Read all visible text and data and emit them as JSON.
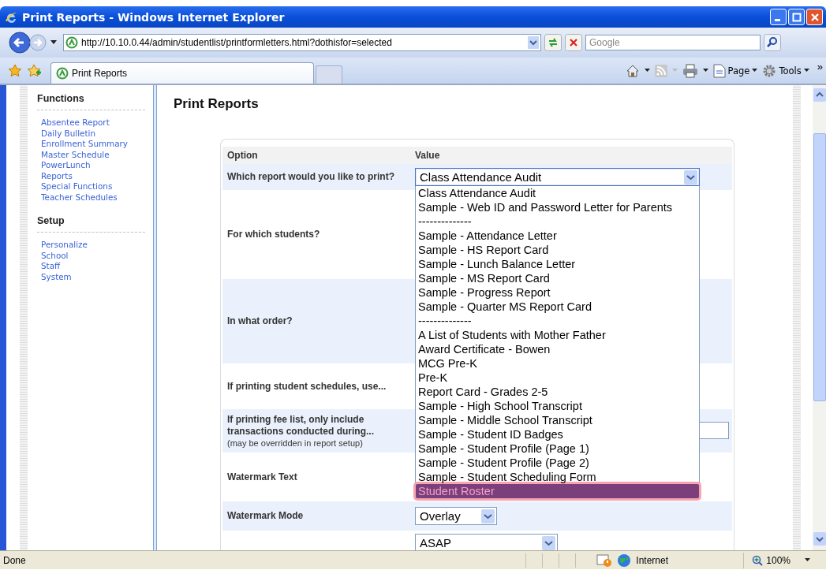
{
  "window": {
    "title": "Print Reports - Windows Internet Explorer"
  },
  "address_bar": {
    "url": "http://10.10.0.44/admin/studentlist/printformletters.html?dothisfor=selected",
    "search_placeholder": "Google"
  },
  "tabs": [
    {
      "label": "Print Reports",
      "selected": true
    }
  ],
  "command_bar": {
    "items": [
      "Page",
      "Tools"
    ],
    "overflow": "»"
  },
  "sidebar": {
    "sections": [
      {
        "title": "Functions",
        "items": [
          "Absentee Report",
          "Daily Bulletin",
          "Enrollment Summary",
          "Master Schedule",
          "PowerLunch",
          "Reports",
          "Special Functions",
          "Teacher Schedules"
        ]
      },
      {
        "title": "Setup",
        "items": [
          "Personalize",
          "School",
          "Staff",
          "System"
        ]
      }
    ]
  },
  "main": {
    "heading": "Print Reports",
    "form": {
      "columns": [
        "Option",
        "Value"
      ],
      "rows": [
        {
          "label": "Which report would you like to print?",
          "kind": "select",
          "value": "Class Attendance Audit",
          "open": true
        },
        {
          "label": "For which students?",
          "kind": "none"
        },
        {
          "label": "In what order?",
          "kind": "none"
        },
        {
          "label": "If printing student schedules, use...",
          "kind": "none"
        },
        {
          "label": "If printing fee list, only include transactions conducted during...",
          "note": "(may be overridden in report setup)",
          "kind": "text"
        },
        {
          "label": "Watermark Text",
          "kind": "none"
        },
        {
          "label": "Watermark Mode",
          "kind": "select",
          "value": "Overlay",
          "open": false
        },
        {
          "label": "",
          "kind": "select",
          "value": "ASAP",
          "open": false
        }
      ]
    },
    "dropdown_options": [
      {
        "label": "Class Attendance Audit",
        "selected": false
      },
      {
        "label": "Sample - Web ID and Password Letter for Parents",
        "selected": false
      },
      {
        "label": "--------------",
        "selected": false
      },
      {
        "label": "Sample - Attendance Letter",
        "selected": false
      },
      {
        "label": "Sample - HS Report Card",
        "selected": false
      },
      {
        "label": "Sample - Lunch Balance Letter",
        "selected": false
      },
      {
        "label": "Sample - MS Report Card",
        "selected": false
      },
      {
        "label": "Sample - Progress Report",
        "selected": false
      },
      {
        "label": "Sample - Quarter MS Report Card",
        "selected": false
      },
      {
        "label": "--------------",
        "selected": false
      },
      {
        "label": "A List of Students with Mother Father",
        "selected": false
      },
      {
        "label": "Award Certificate - Bowen",
        "selected": false
      },
      {
        "label": "MCG Pre-K",
        "selected": false
      },
      {
        "label": "Pre-K",
        "selected": false
      },
      {
        "label": "Report Card - Grades 2-5",
        "selected": false
      },
      {
        "label": "Sample - High School Transcript",
        "selected": false
      },
      {
        "label": "Sample - Middle School Transcript",
        "selected": false
      },
      {
        "label": "Sample - Student ID Badges",
        "selected": false
      },
      {
        "label": "Sample - Student Profile (Page 1)",
        "selected": false
      },
      {
        "label": "Sample - Student Profile (Page 2)",
        "selected": false
      },
      {
        "label": "Sample - Student Scheduling Form",
        "selected": false
      },
      {
        "label": "Student Roster",
        "selected": true
      }
    ]
  },
  "status_bar": {
    "text": "Done",
    "zone": "Internet",
    "zoom": "100%"
  }
}
